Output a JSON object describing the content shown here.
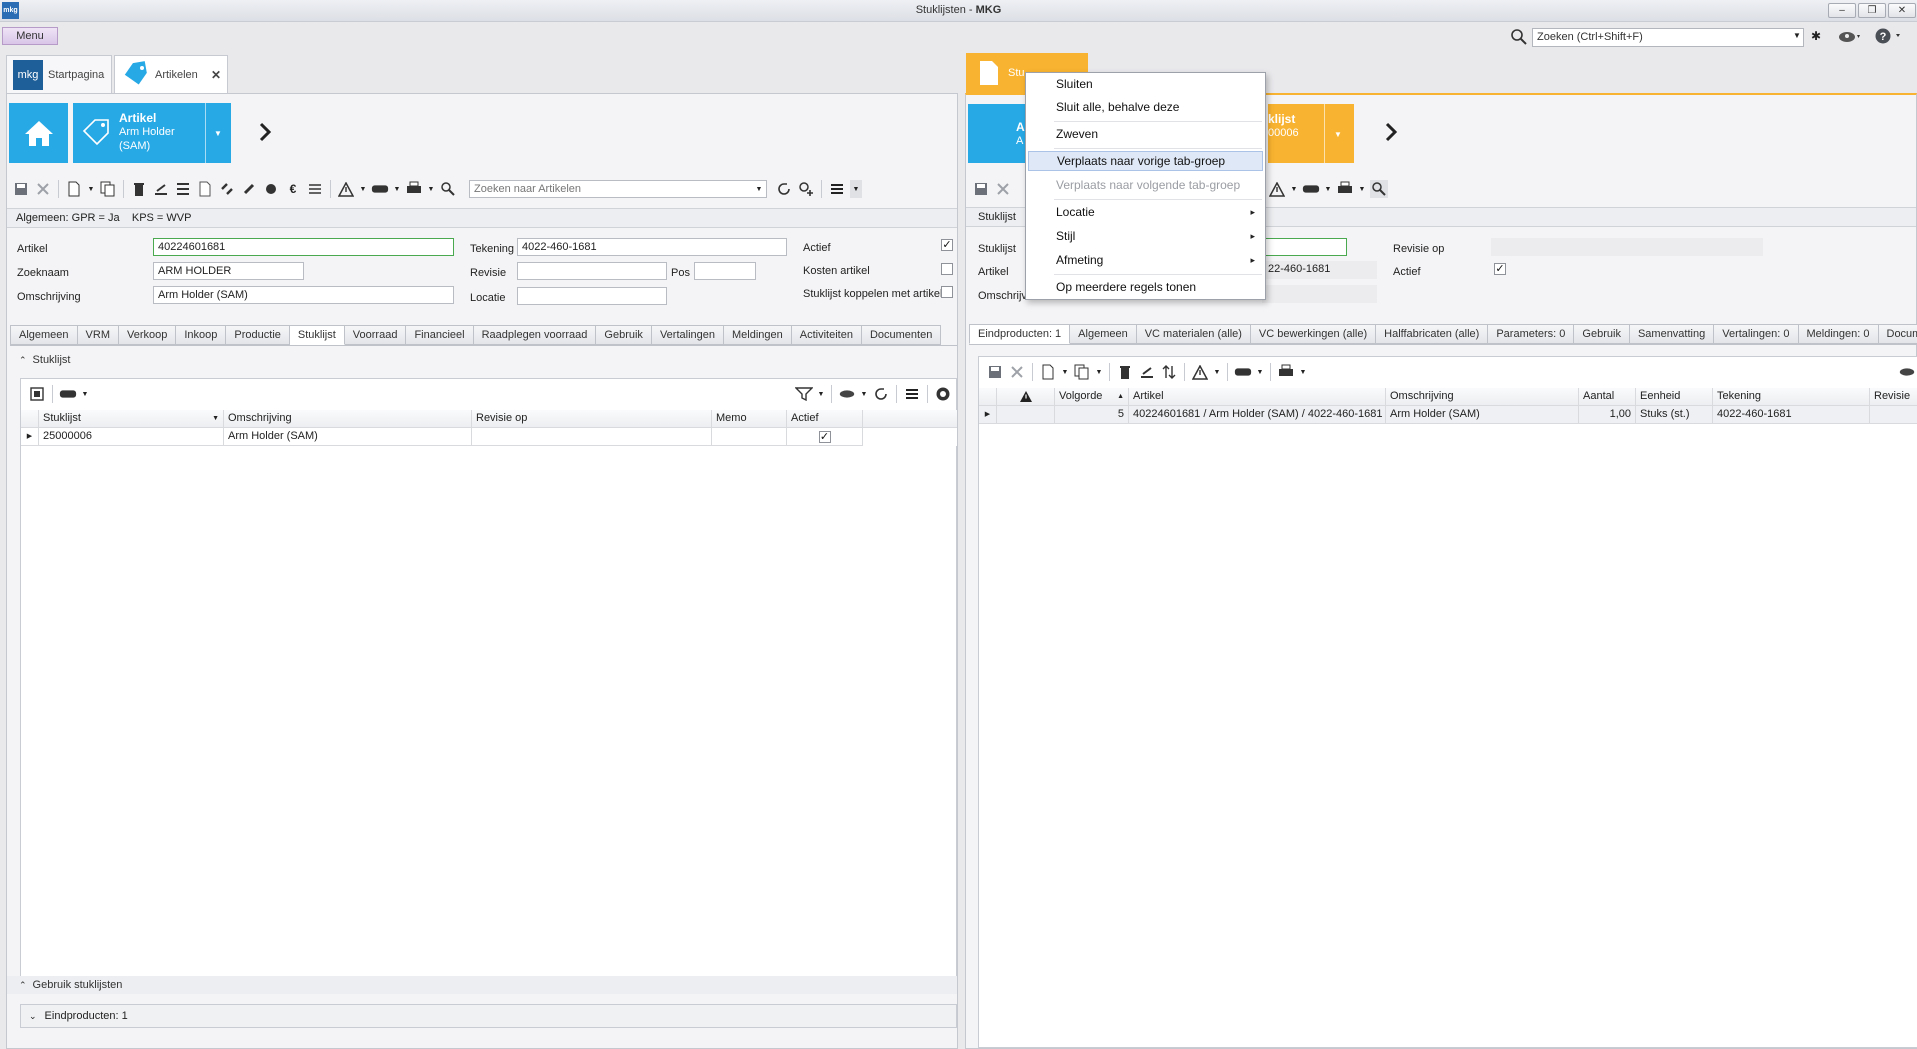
{
  "window": {
    "logo": "mkg",
    "title_prefix": "Stuklijsten - ",
    "title_bold": "MKG",
    "min_label": "‒",
    "restore_label": "❐",
    "close_label": "✕"
  },
  "menu_label": "Menu",
  "global_search_placeholder": "Zoeken (Ctrl+Shift+F)",
  "left": {
    "tabs": [
      {
        "logo": "mkg",
        "label": "Startpagina"
      },
      {
        "label": "Artikelen",
        "close": "✕"
      }
    ],
    "tile": {
      "title": "Artikel",
      "line1": "Arm Holder",
      "line2": "(SAM)"
    },
    "search_placeholder": "Zoeken naar Artikelen",
    "info_bar": "Algemeen: GPR = Ja    KPS = WVP",
    "fields": {
      "artikel_label": "Artikel",
      "artikel_value": "40224601681",
      "zoeknaam_label": "Zoeknaam",
      "zoeknaam_value": "ARM HOLDER",
      "omschrijving_label": "Omschrijving",
      "omschrijving_value": "Arm Holder (SAM)",
      "tekening_label": "Tekening",
      "tekening_value": "4022-460-1681",
      "revisie_label": "Revisie",
      "revisie_value": "",
      "pos_label": "Pos",
      "pos_value": "",
      "locatie_label": "Locatie",
      "locatie_value": "",
      "actief_label": "Actief",
      "kosten_label": "Kosten artikel",
      "koppelen_label": "Stuklijst koppelen met artikel"
    },
    "subtabs": [
      "Algemeen",
      "VRM",
      "Verkoop",
      "Inkoop",
      "Productie",
      "Stuklijst",
      "Voorraad",
      "Financieel",
      "Raadplegen voorraad",
      "Gebruik",
      "Vertalingen",
      "Meldingen",
      "Activiteiten",
      "Documenten"
    ],
    "active_subtab": "Stuklijst",
    "section_title": "Stuklijst",
    "grid": {
      "headers": [
        "Stuklijst",
        "Omschrijving",
        "Revisie op",
        "Memo",
        "Actief"
      ],
      "rows": [
        {
          "stuklijst": "25000006",
          "omschrijving": "Arm Holder (SAM)",
          "revisie": "",
          "memo": "",
          "actief": "✓"
        }
      ]
    },
    "usage_section": "Gebruik stuklijsten",
    "usage_group": "Eindproducten: 1"
  },
  "right": {
    "tab_label": "Stu",
    "tile_blue": {
      "title": "A",
      "line1": "A"
    },
    "tile_orange": {
      "title": "klijst",
      "line1": "00006"
    },
    "form": {
      "stuklijst_header": "Stuklijst",
      "stuklijst_label": "Stuklijst",
      "artikel_label": "Artikel",
      "artikel_value": "22-460-1681",
      "omschrijving_label": "Omschrijvi",
      "revisie_label": "Revisie op",
      "actief_label": "Actief"
    },
    "subtabs": [
      "Eindproducten: 1",
      "Algemeen",
      "VC materialen (alle)",
      "VC bewerkingen (alle)",
      "Halffabricaten (alle)",
      "Parameters: 0",
      "Gebruik",
      "Samenvatting",
      "Vertalingen: 0",
      "Meldingen: 0",
      "Docume"
    ],
    "active_subtab": "Eindproducten: 1",
    "grid": {
      "headers": [
        "",
        "Volgorde",
        "Artikel",
        "Omschrijving",
        "Aantal",
        "Eenheid",
        "Tekening",
        "Revisie"
      ],
      "rows": [
        {
          "volgorde": "5",
          "artikel": "40224601681 / Arm Holder (SAM) / 4022-460-1681",
          "omschrijving": "Arm Holder (SAM)",
          "aantal": "1,00",
          "eenheid": "Stuks (st.)",
          "tekening": "4022-460-1681",
          "revisie": ""
        }
      ]
    }
  },
  "context_menu": {
    "items": [
      {
        "label": "Sluiten"
      },
      {
        "label": "Sluit alle, behalve deze"
      },
      {
        "label": "Zweven"
      },
      {
        "label": "Verplaats naar vorige tab-groep"
      },
      {
        "label": "Verplaats naar volgende tab-groep"
      },
      {
        "label": "Locatie"
      },
      {
        "label": "Stijl"
      },
      {
        "label": "Afmeting"
      },
      {
        "label": "Op meerdere regels tonen"
      }
    ],
    "submenu_arrow": "▸"
  },
  "colors": {
    "accent_blue": "#27a9e6",
    "accent_orange": "#f8b330",
    "menu_purple": "#d9c5e8"
  }
}
